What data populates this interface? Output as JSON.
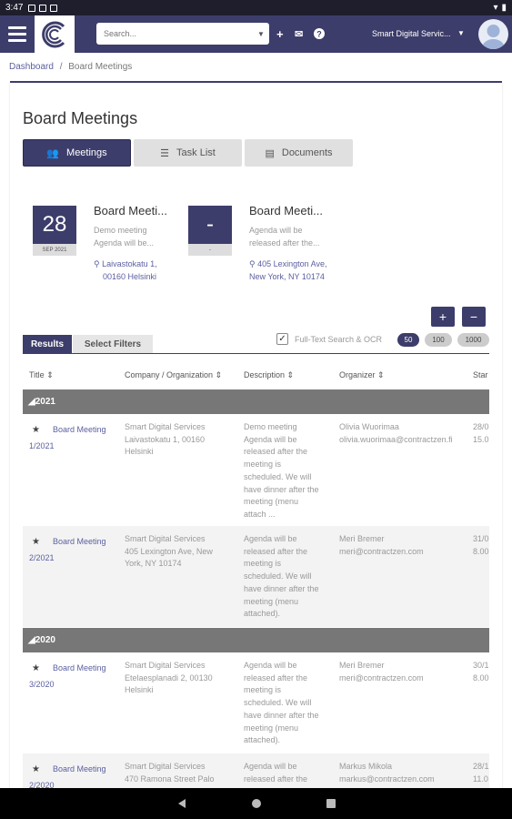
{
  "status": {
    "time": "3:47"
  },
  "topbar": {
    "search_placeholder": "Search...",
    "account": "Smart Digital Servic..."
  },
  "breadcrumb": {
    "home": "Dashboard",
    "sep": "/",
    "current": "Board Meetings"
  },
  "page_title": "Board Meetings",
  "tabs": [
    {
      "label": "Meetings"
    },
    {
      "label": "Task List"
    },
    {
      "label": "Documents"
    }
  ],
  "cards": [
    {
      "day": "28",
      "month": "SEP 2021",
      "title": "Board Meeti...",
      "desc_1": "Demo meeting",
      "desc_2": "Agenda will be...",
      "loc_1": "Laivastokatu 1,",
      "loc_2": "00160 Helsinki"
    },
    {
      "day": "-",
      "month": "-",
      "title": "Board Meeti...",
      "desc_1": "Agenda will be",
      "desc_2": "released after the...",
      "loc_1": "405 Lexington Ave,",
      "loc_2": "New York, NY 10174"
    }
  ],
  "controls": {
    "plus": "+",
    "minus": "−",
    "fulltext": "Full-Text Search & OCR",
    "sizes": [
      "50",
      "100",
      "1000"
    ],
    "results_tab": "Results",
    "filters_tab": "Select Filters"
  },
  "table": {
    "headers": [
      "Title",
      "Company / Organization",
      "Description",
      "Organizer",
      "Star"
    ],
    "groups": [
      {
        "label": "2021",
        "rows": [
          {
            "title_1": "Board Meeting",
            "title_2": "1/2021",
            "company": [
              "Smart Digital Services",
              "Laivastokatu 1, 00160",
              "Helsinki"
            ],
            "desc": [
              "Demo meeting",
              "Agenda will be",
              "released after the",
              "meeting is",
              "scheduled. We will",
              "have dinner after the",
              "meeting (menu",
              "attach ..."
            ],
            "organizer": [
              "Olivia Wuorimaa",
              "olivia.wuorimaa@contractzen.fi"
            ],
            "start": [
              "28/0",
              "15.0"
            ]
          },
          {
            "title_1": "Board Meeting",
            "title_2": "2/2021",
            "company": [
              "Smart Digital Services",
              "405 Lexington Ave, New",
              "York, NY 10174"
            ],
            "desc": [
              "Agenda will be",
              "released after the",
              "meeting is",
              "scheduled. We will",
              "have dinner after the",
              "meeting (menu",
              "attached)."
            ],
            "organizer": [
              "Meri Bremer",
              "meri@contractzen.com"
            ],
            "start": [
              "31/0",
              "8.00"
            ]
          }
        ]
      },
      {
        "label": "2020",
        "rows": [
          {
            "title_1": "Board Meeting",
            "title_2": "3/2020",
            "company": [
              "Smart Digital Services",
              "Etelaesplanadi 2, 00130",
              "Helsinki"
            ],
            "desc": [
              "Agenda will be",
              "released after the",
              "meeting is",
              "scheduled. We will",
              "have dinner after the",
              "meeting (menu",
              "attached)."
            ],
            "organizer": [
              "Meri Bremer",
              "meri@contractzen.com"
            ],
            "start": [
              "30/1",
              "8.00"
            ]
          },
          {
            "title_1": "Board Meeting",
            "title_2": "2/2020",
            "company": [
              "Smart Digital Services",
              "470 Ramona Street Palo"
            ],
            "desc": [
              "Agenda will be",
              "released after the"
            ],
            "organizer": [
              "Markus Mikola",
              "markus@contractzen.com"
            ],
            "start": [
              "28/1",
              "11.0"
            ]
          }
        ]
      }
    ]
  },
  "colors": {
    "primary": "#3d3d6b",
    "link": "#5b5fa0",
    "group": "#777777"
  }
}
